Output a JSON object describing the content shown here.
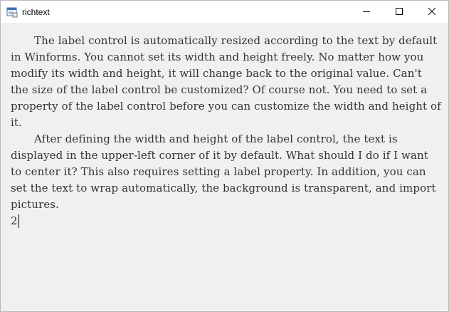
{
  "window": {
    "title": "richtext",
    "icon": "winforms-app-icon",
    "controls": {
      "minimize": "minimize-icon",
      "maximize": "maximize-icon",
      "close": "close-icon"
    }
  },
  "editor": {
    "paragraphs": [
      "The label control is automatically resized according to the text by default in Winforms. You cannot set its width and height freely. No matter how you modify its width and height, it will change back to the original value. Can't the size of the label control be customized? Of course not. You need to set a property of the label control before you can customize the width and height of it.",
      "After defining the width and height of the label control, the text is displayed in the upper-left corner of it by default. What should I do if I want to center it? This also requires setting a label property. In addition, you can set the text to wrap automatically, the background is transparent, and import pictures."
    ],
    "current_line": "2"
  },
  "colors": {
    "window_bg": "#f0f0f0",
    "titlebar_bg": "#ffffff",
    "text": "#333333"
  }
}
